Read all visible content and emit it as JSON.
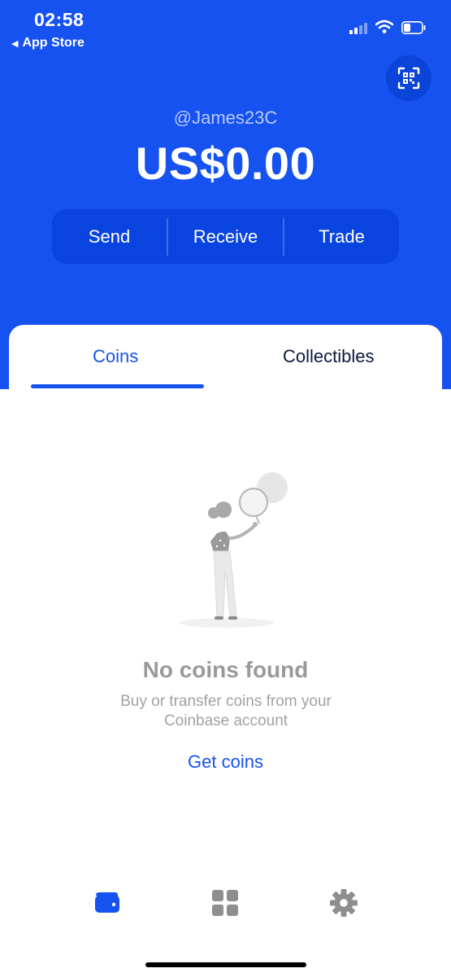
{
  "status_bar": {
    "time": "02:58",
    "back_label": "App Store"
  },
  "header": {
    "username": "@James23C",
    "balance": "US$0.00",
    "qr_icon": "qr-scan-icon"
  },
  "actions": {
    "send": "Send",
    "receive": "Receive",
    "trade": "Trade"
  },
  "tabs": [
    {
      "label": "Coins",
      "active": true
    },
    {
      "label": "Collectibles",
      "active": false
    }
  ],
  "empty_state": {
    "title": "No coins found",
    "description": "Buy or transfer coins from your Coinbase account",
    "cta": "Get coins"
  },
  "bottom_nav": [
    {
      "icon": "wallet-icon",
      "active": true
    },
    {
      "icon": "apps-grid-icon",
      "active": false
    },
    {
      "icon": "gear-icon",
      "active": false
    }
  ],
  "colors": {
    "brand_blue": "#1652f0",
    "action_bar": "#0a44e0",
    "inactive_icon": "#8e8e8e"
  }
}
